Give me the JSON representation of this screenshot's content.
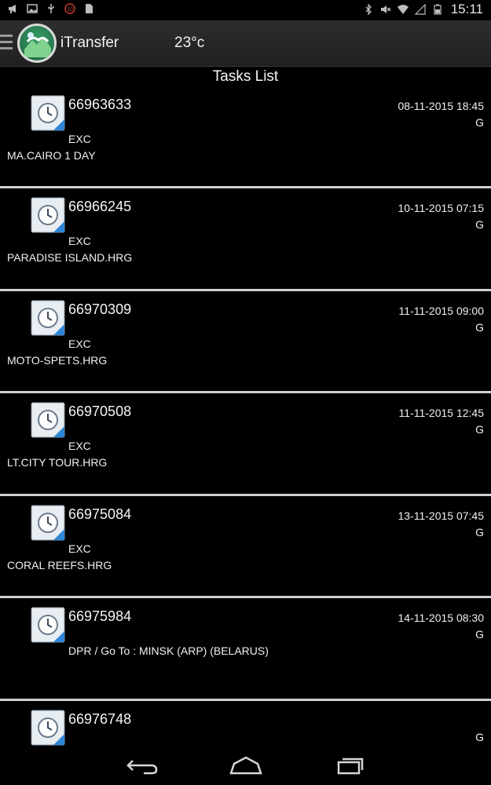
{
  "status_bar": {
    "time": "15:11",
    "left_icons": [
      "megaphone-icon",
      "image-icon",
      "usb-icon",
      "alarm-badge-icon",
      "sd-card-icon"
    ],
    "right_icons": [
      "bluetooth-icon",
      "mute-icon",
      "wifi-icon",
      "signal-icon",
      "battery-icon"
    ]
  },
  "app_bar": {
    "title": "iTransfer",
    "temperature": "23°c"
  },
  "page": {
    "title": "Tasks List"
  },
  "tasks": [
    {
      "number": "66963633",
      "datetime": "08-11-2015 18:45",
      "flag": "G",
      "type": "EXC",
      "location": "MA.CAIRO 1 DAY"
    },
    {
      "number": "66966245",
      "datetime": "10-11-2015 07:15",
      "flag": "G",
      "type": "EXC",
      "location": "PARADISE ISLAND.HRG"
    },
    {
      "number": "66970309",
      "datetime": "11-11-2015 09:00",
      "flag": "G",
      "type": "EXC",
      "location": "MOTO-SPETS.HRG"
    },
    {
      "number": "66970508",
      "datetime": "11-11-2015 12:45",
      "flag": "G",
      "type": "EXC",
      "location": "LT.CITY TOUR.HRG"
    },
    {
      "number": "66975084",
      "datetime": "13-11-2015 07:45",
      "flag": "G",
      "type": "EXC",
      "location": "CORAL REEFS.HRG"
    },
    {
      "number": "66975984",
      "datetime": "14-11-2015 08:30",
      "flag": "G",
      "type": "DPR / Go To : MINSK (ARP) (BELARUS)",
      "location": ""
    },
    {
      "number": "66976748",
      "datetime": "",
      "flag": "G",
      "type": "",
      "location": ""
    }
  ],
  "nav_bar": {
    "buttons": [
      "back-icon",
      "home-icon",
      "recents-icon"
    ]
  }
}
